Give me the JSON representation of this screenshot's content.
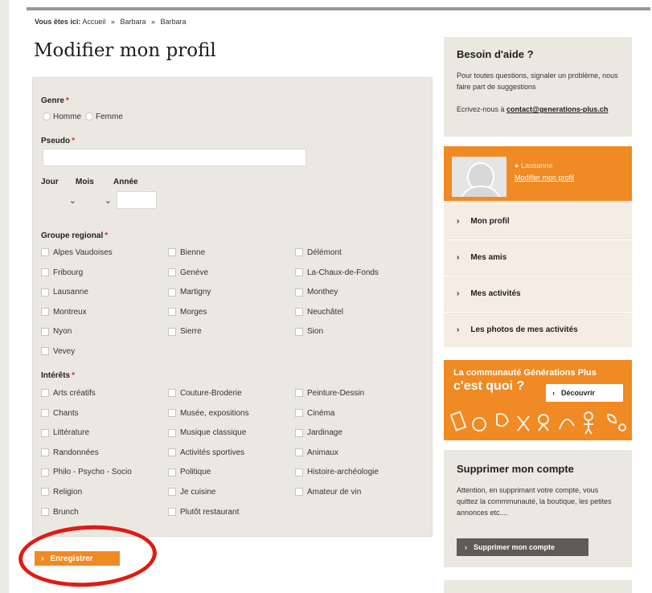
{
  "breadcrumb": {
    "prefix": "Vous êtes ici:",
    "items": [
      "Accueil",
      "Barbara",
      "Barbara"
    ],
    "sep": "»"
  },
  "page_title": "Modifier mon profil",
  "form": {
    "genre": {
      "label": "Genre",
      "req": "*",
      "options": [
        "Homme",
        "Femme"
      ]
    },
    "pseudo": {
      "label": "Pseudo",
      "req": "*",
      "value": ""
    },
    "date": {
      "jour": "Jour",
      "mois": "Mois",
      "annee": "Année"
    },
    "groupe": {
      "label": "Groupe regional",
      "req": "*",
      "options": [
        "Alpes Vaudoises",
        "Bienne",
        "Délémont",
        "Fribourg",
        "Genève",
        "La-Chaux-de-Fonds",
        "Lausanne",
        "Martigny",
        "Monthey",
        "Montreux",
        "Morges",
        "Neuchâtel",
        "Nyon",
        "Sierre",
        "Sion",
        "Vevey"
      ]
    },
    "interets": {
      "label": "Intérêts",
      "req": "*",
      "options": [
        "Arts créatifs",
        "Couture-Broderie",
        "Peinture-Dessin",
        "Chants",
        "Musée, expositions",
        "Cinéma",
        "Littérature",
        "Musique classique",
        "Jardinage",
        "Randonnées",
        "Activités sportives",
        "Animaux",
        "Philo - Psycho - Socio",
        "Politique",
        "Histoire-archéologie",
        "Religion",
        "Je cuisine",
        "Amateur de vin",
        "Brunch",
        "Plutôt restaurant"
      ]
    },
    "save_label": "Enregistrer"
  },
  "help": {
    "title": "Besoin d'aide ?",
    "text": "Pour toutes questions, signaler un problème, nous faire part de suggestions",
    "contact_prefix": "Ecrivez-nous à ",
    "contact_email": "contact@generations-plus.ch"
  },
  "profile": {
    "location": "Lausanne",
    "edit_link": "Modifier mon profil",
    "menu": [
      "Mon profil",
      "Mes amis",
      "Mes activités",
      "Les photos de mes activités"
    ]
  },
  "community": {
    "title": "La communauté Générations Plus",
    "question": "c'est quoi ?",
    "discover": "Découvrir"
  },
  "delete_account": {
    "title": "Supprimer mon compte",
    "text": "Attention, en supprimant votre compte, vous quittez la commmunauté, la boutique, les petites annonces etc....",
    "button": "Supprimer mon compte"
  },
  "colors": {
    "accent": "#f08a24",
    "panel": "#ebe8e2",
    "required": "#d52a1d",
    "annotation": "#e01b12"
  }
}
